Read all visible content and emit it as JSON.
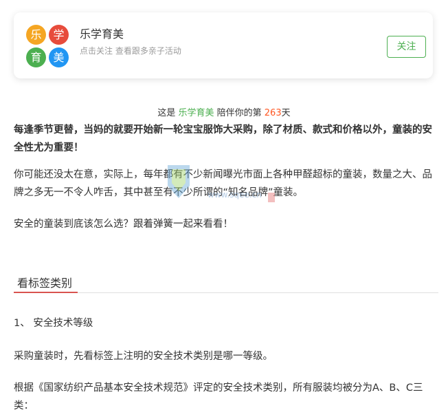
{
  "account": {
    "logo_chars": [
      "乐",
      "学",
      "育",
      "美"
    ],
    "logo_colors": [
      "#f5a623",
      "#e74c3c",
      "#4caf50",
      "#2196f3"
    ],
    "name": "乐学育美",
    "subtitle": "点击关注 查看跟多亲子活动",
    "follow_label": "关注"
  },
  "companion": {
    "prefix": "这是 ",
    "name": "乐学育美",
    "middle": " 陪伴你的第 ",
    "days": "263",
    "suffix": "天"
  },
  "article": {
    "intro": "每逢季节更替，当妈的就要开始新一轮宝宝服饰大采购，除了材质、款式和价格以外，童装的安全性尤为重要！",
    "para2": "你可能还没太在意，实际上，每年都有不少新闻曝光市面上各种甲醛超标的童装，数量之大、品牌之多无一不令人咋舌，其中甚至有不少所谓的“知名品牌”童装。",
    "para3": "安全的童装到底该怎么选？跟着弹簧一起来看看！",
    "section_heading": "看标签类别",
    "item1": "1、 安全技术等级",
    "para4": "采购童装时，先看标签上注明的安全技术类别是哪一等级。",
    "para5": "根据《国家纺织产品基本安全技术规范》评定的安全技术类别，所有服装均被分为A、B、C三类："
  },
  "watermark": {
    "url": "www.sqee.cn"
  }
}
